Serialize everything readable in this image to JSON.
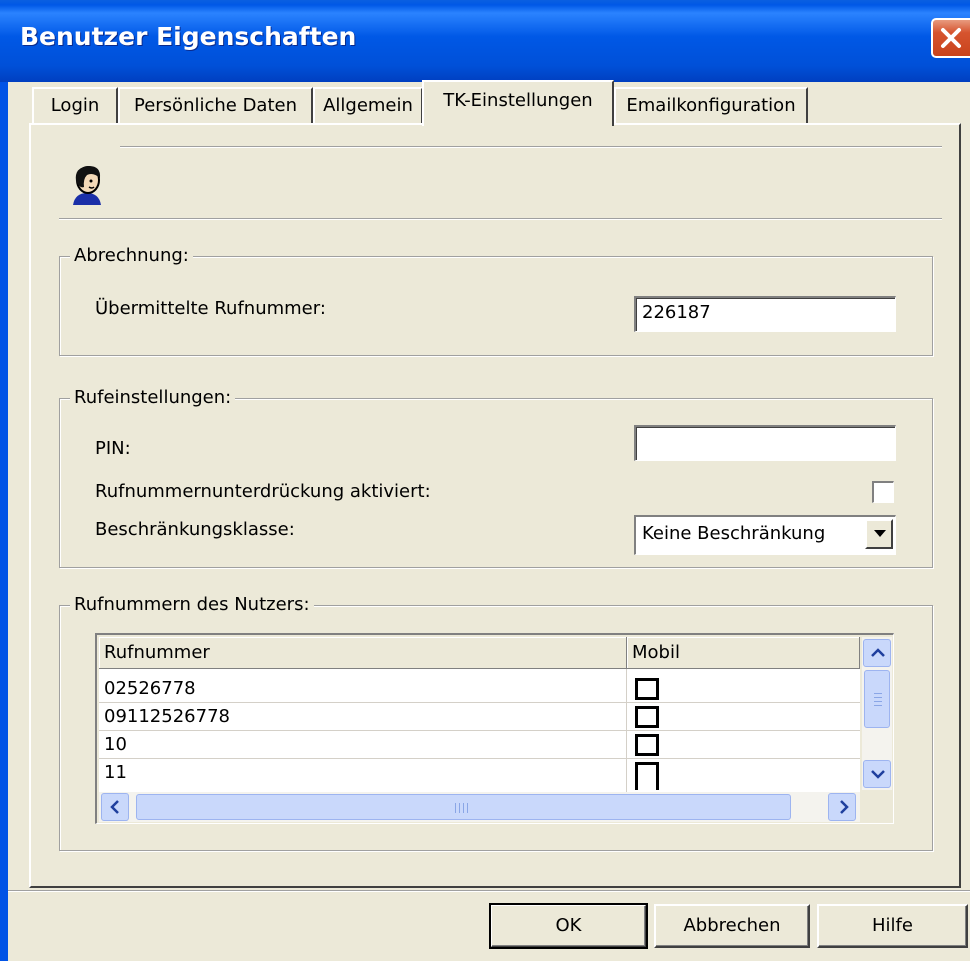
{
  "window": {
    "title": "Benutzer Eigenschaften"
  },
  "tabs": [
    {
      "label": "Login"
    },
    {
      "label": "Persönliche Daten"
    },
    {
      "label": "Allgemein"
    },
    {
      "label": "TK-Einstellungen"
    },
    {
      "label": "Emailkonfiguration"
    }
  ],
  "active_tab": "TK-Einstellungen",
  "abrechnung": {
    "group_label": "Abrechnung:",
    "rufnummer_label": "Übermittelte Rufnummer:",
    "rufnummer_value": "226187"
  },
  "rufeinstellungen": {
    "group_label": "Rufeinstellungen:",
    "pin_label": "PIN:",
    "pin_value": "",
    "unterdrueckung_label": "Rufnummernunterdrückung aktiviert:",
    "unterdrueckung_checked": false,
    "klasse_label": "Beschränkungsklasse:",
    "klasse_value": "Keine Beschränkung"
  },
  "nutzer_rufnummern": {
    "group_label": "Rufnummern des Nutzers:",
    "columns": [
      "Rufnummer",
      "Mobil"
    ],
    "rows": [
      {
        "rufnummer": "02526778",
        "mobil": false
      },
      {
        "rufnummer": "09112526778",
        "mobil": false
      },
      {
        "rufnummer": "10",
        "mobil": false
      },
      {
        "rufnummer": "11",
        "mobil": false
      }
    ]
  },
  "buttons": {
    "ok": "OK",
    "cancel": "Abbrechen",
    "help": "Hilfe"
  },
  "icons": [
    "close-icon",
    "user-avatar-icon",
    "chevron-down-icon",
    "scroll-up-icon",
    "scroll-down-icon",
    "scroll-left-icon",
    "scroll-right-icon"
  ],
  "colors": {
    "titlebar": "#0058e6",
    "close": "#d6542f",
    "face": "#ece9d8"
  }
}
